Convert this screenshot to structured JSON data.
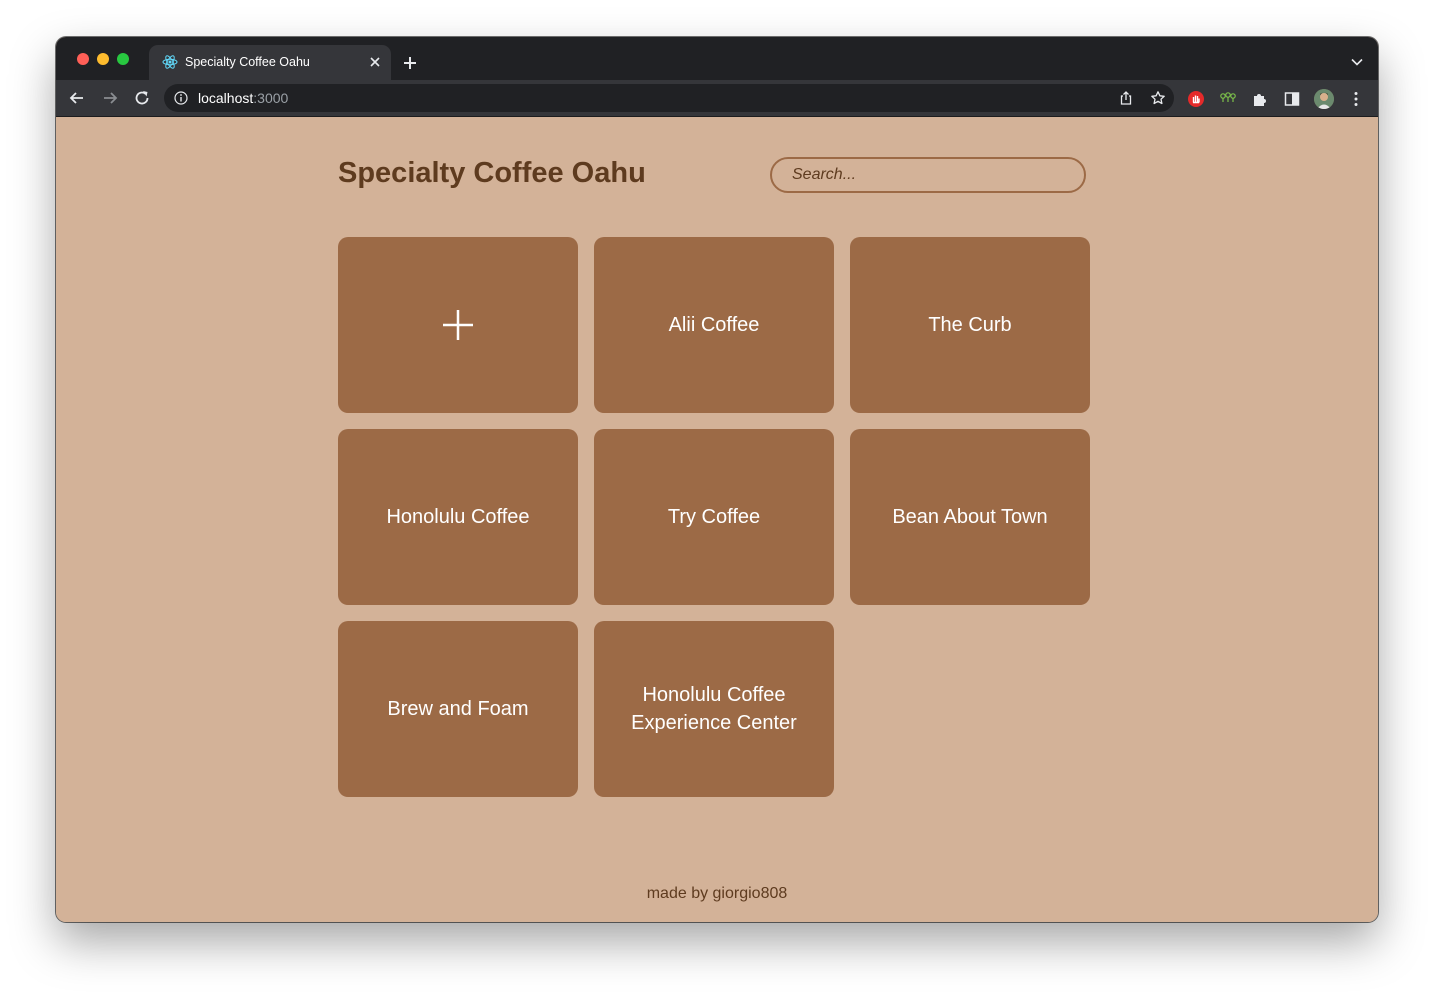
{
  "browser": {
    "tab_title": "Specialty Coffee Oahu",
    "url_host": "localhost",
    "url_port": ":3000"
  },
  "header": {
    "title": "Specialty Coffee Oahu",
    "search_placeholder": "Search..."
  },
  "add_card": {
    "icon": "plus-icon"
  },
  "shops": [
    "Alii Coffee",
    "The Curb",
    "Honolulu Coffee",
    "Try Coffee",
    "Bean About Town",
    "Brew and Foam",
    "Honolulu Coffee Experience Center"
  ],
  "footer": {
    "text": "made by giorgio808"
  },
  "colors": {
    "page_background": "#d3b298",
    "card": "#9c6a46",
    "title_text": "#5e3b1f",
    "card_text": "#ffffff"
  }
}
